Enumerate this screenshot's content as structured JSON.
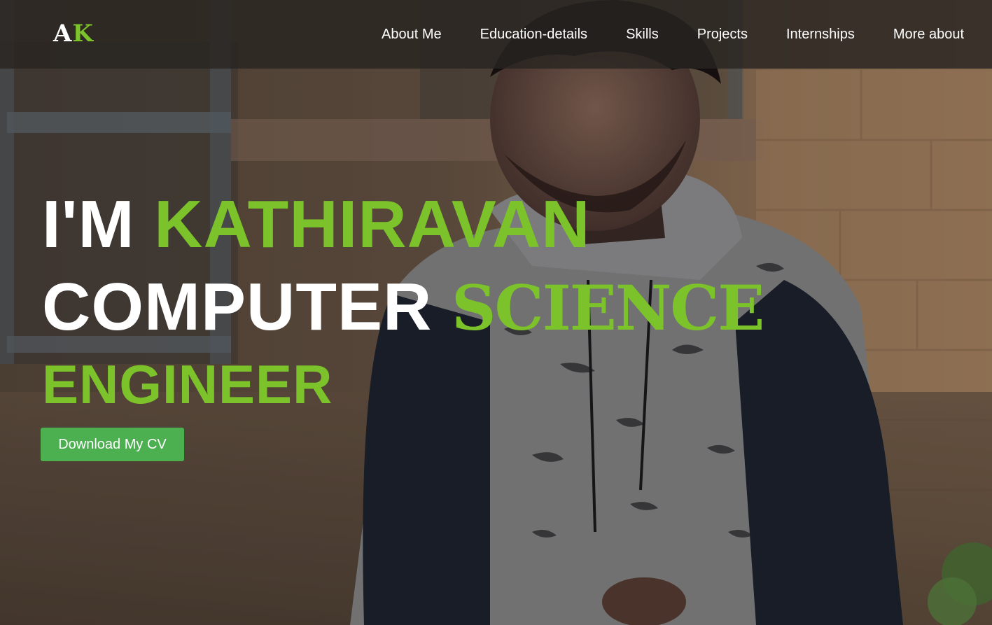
{
  "logo": {
    "letter1": "A",
    "letter2": "K"
  },
  "nav": {
    "items": [
      {
        "label": "About Me"
      },
      {
        "label": "Education-details"
      },
      {
        "label": "Skills"
      },
      {
        "label": "Projects"
      },
      {
        "label": "Internships"
      },
      {
        "label": "More about"
      }
    ]
  },
  "hero": {
    "prefix": "I'M",
    "name": "KATHIRAVAN",
    "word_computer": "COMPUTER",
    "word_science": "SCIENCE",
    "word_engineer": "ENGINEER",
    "cv_button_label": "Download My CV"
  },
  "colors": {
    "accent": "#7cc22a",
    "button": "#4caf50",
    "navbar": "#282421"
  }
}
